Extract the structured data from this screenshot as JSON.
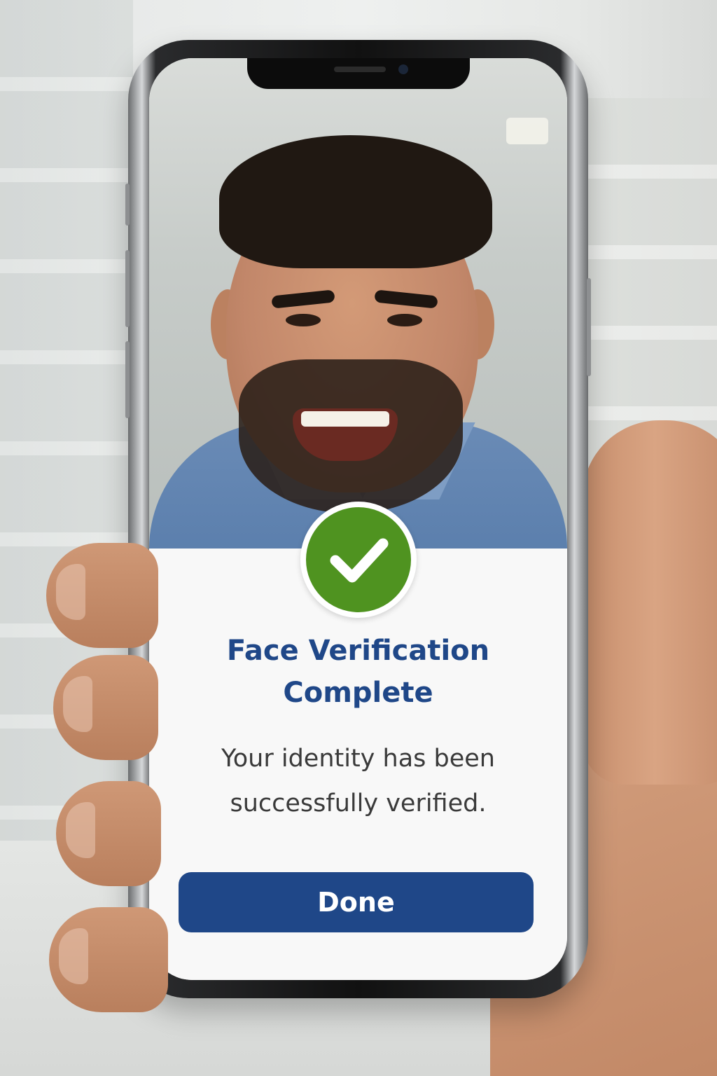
{
  "verification": {
    "status_icon": "checkmark-icon",
    "title": "Face Verification Complete",
    "message": "Your identity has been successfully verified.",
    "done_label": "Done"
  },
  "colors": {
    "title": "#1f4788",
    "button": "#1f4788",
    "success": "#4f9320",
    "message": "#3a3a3a"
  }
}
